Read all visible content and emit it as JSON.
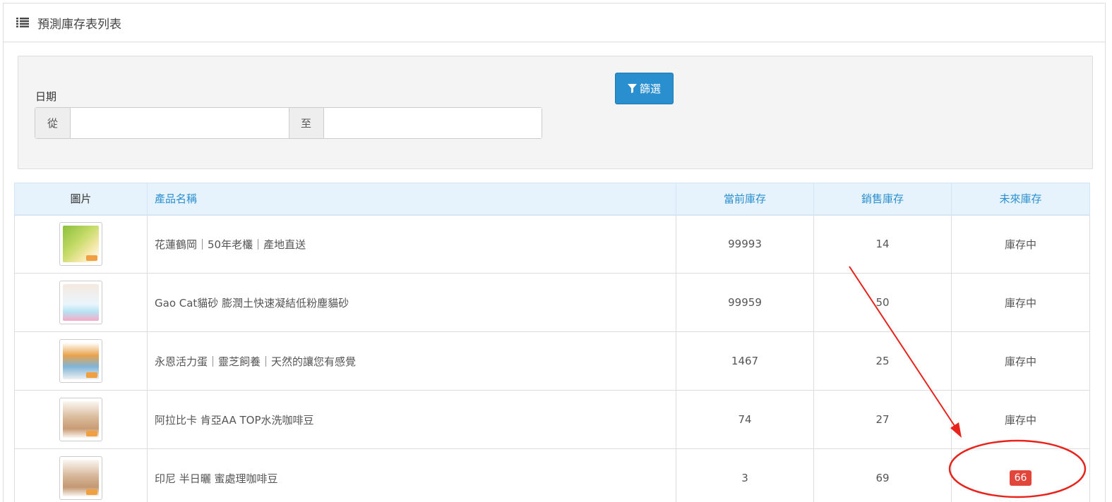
{
  "panel": {
    "title": "預測庫存表列表"
  },
  "filter": {
    "date_label": "日期",
    "from_label": "從",
    "to_label": "至",
    "from_value": "",
    "to_value": "",
    "button_label": "篩選"
  },
  "table": {
    "headers": [
      "圖片",
      "產品名稱",
      "當前庫存",
      "銷售庫存",
      "未來庫存"
    ],
    "rows": [
      {
        "name": "花蓮鶴岡｜50年老欉｜產地直送",
        "current": "99993",
        "sales": "14",
        "future": "庫存中"
      },
      {
        "name": "Gao Cat貓砂 膨潤土快速凝結低粉塵貓砂",
        "current": "99959",
        "sales": "50",
        "future": "庫存中"
      },
      {
        "name": "永恩活力蛋｜靈芝飼養｜天然的讓您有感覺",
        "current": "1467",
        "sales": "25",
        "future": "庫存中"
      },
      {
        "name": "阿拉比卡 肯亞AA TOP水洗咖啡豆",
        "current": "74",
        "sales": "27",
        "future": "庫存中"
      },
      {
        "name": "印尼 半日曬 蜜處理咖啡豆",
        "current": "3",
        "sales": "69",
        "future": "66"
      }
    ]
  },
  "colors": {
    "accent": "#2a8fcf",
    "badge": "#e2463b",
    "annotation": "#e8231c"
  }
}
